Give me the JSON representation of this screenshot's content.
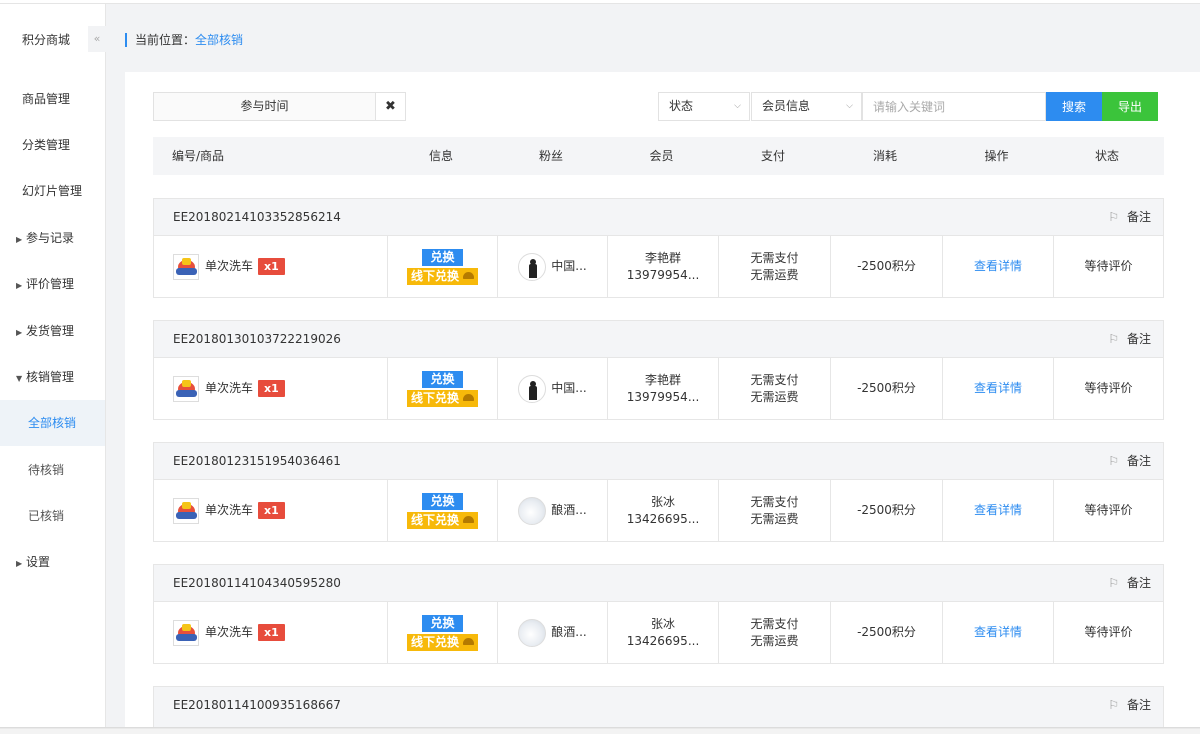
{
  "sidebar": {
    "title": "积分商城",
    "collapse_icon": "«",
    "items": [
      {
        "label": "商品管理",
        "type": "item"
      },
      {
        "label": "分类管理",
        "type": "item"
      },
      {
        "label": "幻灯片管理",
        "type": "item"
      },
      {
        "label": "参与记录",
        "type": "group"
      },
      {
        "label": "评价管理",
        "type": "group"
      },
      {
        "label": "发货管理",
        "type": "group"
      },
      {
        "label": "核销管理",
        "type": "group-open"
      },
      {
        "label": "全部核销",
        "type": "child-active"
      },
      {
        "label": "待核销",
        "type": "child"
      },
      {
        "label": "已核销",
        "type": "child"
      },
      {
        "label": "设置",
        "type": "group"
      }
    ]
  },
  "breadcrumb": {
    "prefix": "当前位置：",
    "current": "全部核销"
  },
  "filters": {
    "time_label": "参与时间",
    "clear_icon": "✖",
    "status_label": "状态",
    "member_label": "会员信息",
    "keyword_placeholder": "请输入关键词",
    "search_label": "搜索",
    "export_label": "导出"
  },
  "table": {
    "columns": [
      "编号/商品",
      "信息",
      "粉丝",
      "会员",
      "支付",
      "消耗",
      "操作",
      "状态"
    ],
    "note_label": "备注",
    "orders": [
      {
        "no": "EE20180214103352856214",
        "product": "单次洗车",
        "qty": "x1",
        "badge1": "兑换",
        "badge2": "线下兑换",
        "fan": "中国...",
        "avatar": "person",
        "member_name": "李艳群",
        "member_phone": "13979954...",
        "pay1": "无需支付",
        "pay2": "无需运费",
        "cost": "-2500积分",
        "action": "查看详情",
        "status": "等待评价"
      },
      {
        "no": "EE20180130103722219026",
        "product": "单次洗车",
        "qty": "x1",
        "badge1": "兑换",
        "badge2": "线下兑换",
        "fan": "中国...",
        "avatar": "person",
        "member_name": "李艳群",
        "member_phone": "13979954...",
        "pay1": "无需支付",
        "pay2": "无需运费",
        "cost": "-2500积分",
        "action": "查看详情",
        "status": "等待评价"
      },
      {
        "no": "EE20180123151954036461",
        "product": "单次洗车",
        "qty": "x1",
        "badge1": "兑换",
        "badge2": "线下兑换",
        "fan": "酿酒...",
        "avatar": "sphere",
        "member_name": "张冰",
        "member_phone": "13426695...",
        "pay1": "无需支付",
        "pay2": "无需运费",
        "cost": "-2500积分",
        "action": "查看详情",
        "status": "等待评价"
      },
      {
        "no": "EE20180114104340595280",
        "product": "单次洗车",
        "qty": "x1",
        "badge1": "兑换",
        "badge2": "线下兑换",
        "fan": "酿酒...",
        "avatar": "sphere",
        "member_name": "张冰",
        "member_phone": "13426695...",
        "pay1": "无需支付",
        "pay2": "无需运费",
        "cost": "-2500积分",
        "action": "查看详情",
        "status": "等待评价"
      },
      {
        "no": "EE20180114100935168667"
      }
    ]
  }
}
